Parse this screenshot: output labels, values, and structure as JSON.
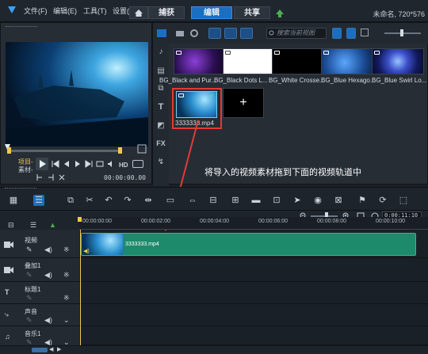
{
  "menubar": {
    "items": [
      "文件(F)",
      "编辑(E)",
      "工具(T)",
      "设置(S"
    ],
    "tabs": [
      "捕获",
      "编辑",
      "共享"
    ],
    "active_tab": "编辑",
    "project_info": "未命名, 720*576"
  },
  "player": {
    "project_label": "项目-",
    "clip_label": "素材-",
    "hd_label": "HD",
    "timecode": "00:00:00.00"
  },
  "library": {
    "search_placeholder": "搜索当前视图",
    "thumbnails": [
      {
        "label": "BG_Black and Pur..."
      },
      {
        "label": "BG_Black Dots L..."
      },
      {
        "label": "BG_White Crosse..."
      },
      {
        "label": "BG_Blue Hexago..."
      },
      {
        "label": "BG_Blue Swirl Lo..."
      },
      {
        "label": "3333333.mp4"
      }
    ],
    "add_label": "+"
  },
  "instruction": "将导入的视频素材拖到下面的视频轨道中",
  "timeline": {
    "zoom_timecode": "0:00:11:10 N",
    "ruler_ticks": [
      "00:00:00:00",
      "00:00:02:00",
      "00:00:04:00",
      "00:00:06:00",
      "00:00:08:00",
      "00:00:10:00"
    ],
    "tracks": [
      "视频",
      "叠加1",
      "标题1",
      "声音",
      "音乐1"
    ],
    "clip_name": "3333333.mp4"
  },
  "colors": {
    "accent": "#1b6fc0",
    "clip": "#1e8a6c",
    "highlight": "#e53935",
    "playhead_marker": "#f2c94c"
  }
}
